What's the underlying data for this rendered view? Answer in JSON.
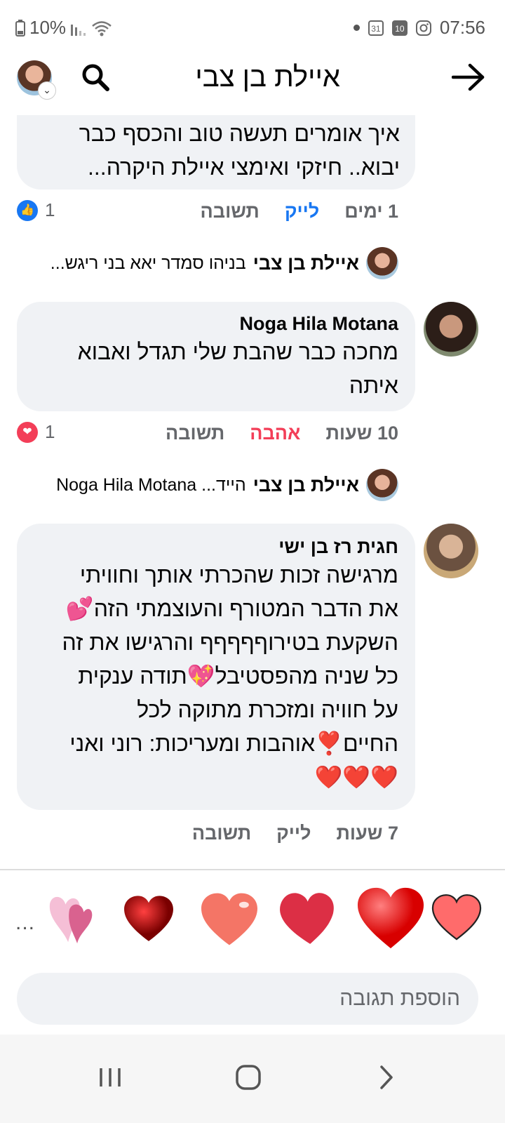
{
  "status": {
    "battery": "10%",
    "time": "07:56",
    "calendar_day": "31",
    "date_badge": "10"
  },
  "header": {
    "title": "איילת בן צבי",
    "icons": [
      "avatar",
      "search-icon",
      "back-arrow-icon"
    ]
  },
  "comments": [
    {
      "text_lines": [
        "איך אומרים תעשה טוב והכסף כבר",
        "יבוא.. חיזקי ואימצי איילת היקרה..."
      ],
      "time": "1 ימים",
      "action_reaction": "לייק",
      "reply_label": "תשובה",
      "reaction_count": "1",
      "reaction_type": "like"
    },
    {
      "name": "Noga Hila Motana",
      "text_lines": [
        "מחכה כבר שהבת שלי תגדל ואבוא",
        "איתה"
      ],
      "time": "10 שעות",
      "action_reaction": "אהבה",
      "reply_label": "תשובה",
      "reaction_count": "1",
      "reaction_type": "love"
    },
    {
      "name": "חגית רז בן ישי",
      "text_lines": [
        "מרגישה זכות שהכרתי אותך וחוויתי",
        "את הדבר המטורף והעוצמתי הזה💕",
        "השקעת בטירוףףףףף והרגישו את זה",
        "כל שניה מהפסטיבל💖תודה ענקית",
        "על חוויה ומזכרת מתוקה לכל",
        "החיים❣️אוהבות ומעריכות: רוני ואני",
        "❤️❤️❤️"
      ],
      "time": "7 שעות",
      "action_reaction": "לייק",
      "reply_label": "תשובה"
    }
  ],
  "replies": [
    {
      "name": "איילת בן צבי",
      "preview": "בניהו סמדר יאא בני ריגש..."
    },
    {
      "name": "איילת בן צבי",
      "preview": "הייד... Noga Hila Motana"
    }
  ],
  "sticker_bar": {
    "stickers": [
      "heart-sticker-1",
      "heart-sticker-2",
      "heart-sticker-3",
      "heart-sticker-4",
      "heart-sticker-5",
      "heart-sticker-6"
    ],
    "more": "..."
  },
  "compose": {
    "placeholder": "הוספת תגובה"
  },
  "navbar": {
    "buttons": [
      "recent-apps",
      "home",
      "back"
    ]
  },
  "colors": {
    "like_blue": "#1877f2",
    "love_red": "#f33e58",
    "bubble_bg": "#f0f2f5",
    "meta_gray": "#65676b"
  }
}
